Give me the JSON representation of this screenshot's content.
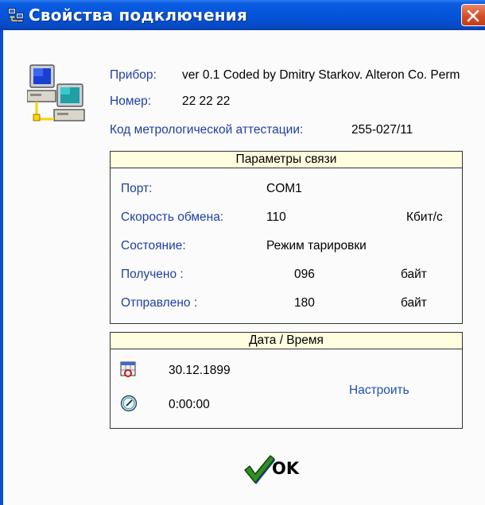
{
  "window": {
    "title": "Свойства подключения"
  },
  "device": {
    "device_label": "Прибор:",
    "device_value": "ver 0.1 Coded by Dmitry Starkov. Alteron Co. Perm",
    "number_label": "Номер:",
    "number_value": "22 22 22",
    "cert_label": "Код метрологической аттестации:",
    "cert_value": "255-027/11"
  },
  "comm": {
    "title": "Параметры связи",
    "port_label": "Порт:",
    "port_value": "COM1",
    "speed_label": "Скорость обмена:",
    "speed_value": "110",
    "speed_unit": "Кбит/с",
    "state_label": "Состояние:",
    "state_value": "Режим тарировки",
    "received_label": "Получено :",
    "received_value": "096",
    "received_unit": "байт",
    "sent_label": "Отправлено :",
    "sent_value": "180",
    "sent_unit": "байт"
  },
  "datetime": {
    "title": "Дата / Время",
    "date_value": "30.12.1899",
    "time_value": "0:00:00",
    "configure_label": "Настроить"
  },
  "ok_label": "OK",
  "icons": {
    "title": "network-icon",
    "computers": "computers-icon",
    "calendar": "calendar-icon",
    "clock": "clock-icon",
    "ok": "checkmark-icon",
    "close": "close-icon"
  }
}
